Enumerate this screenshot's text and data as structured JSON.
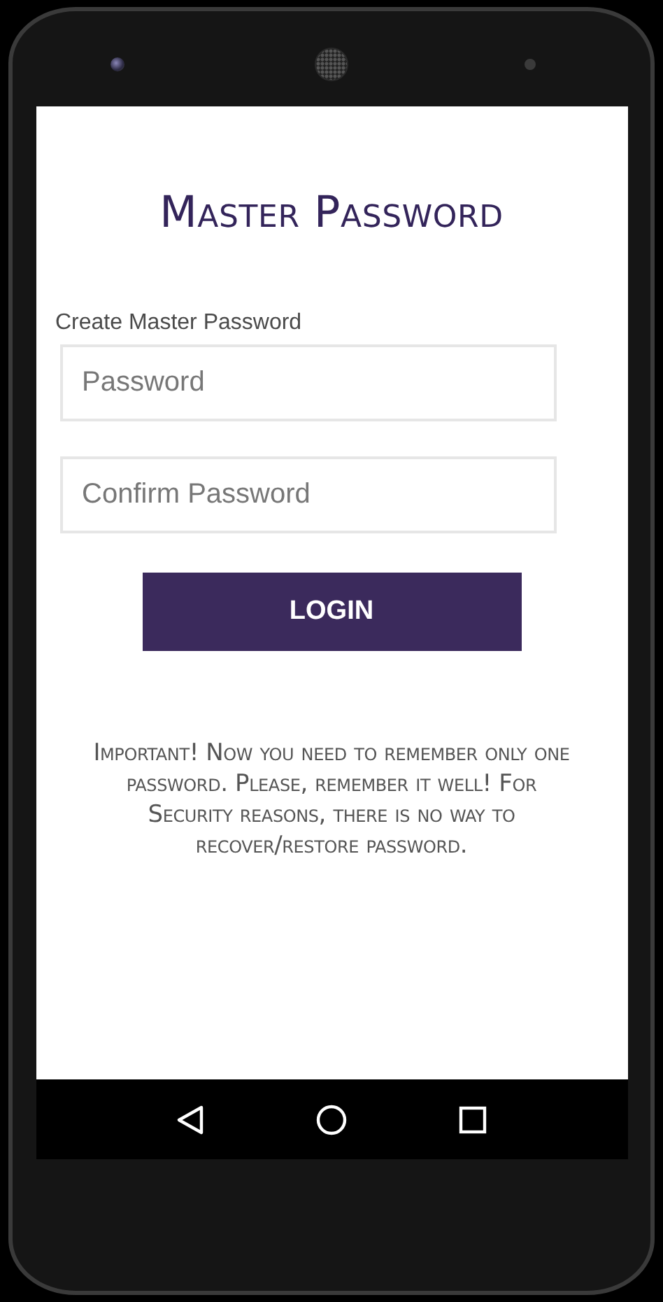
{
  "screen": {
    "title": "Master Password",
    "field_label": "Create Master Password",
    "fields": [
      {
        "placeholder": "Password"
      },
      {
        "placeholder": "Confirm Password"
      }
    ],
    "button": "LOGIN",
    "notice": "Important! Now you need to remember only one password. Please, remember it well! For Security reasons, there is no way to recover/restore password."
  }
}
